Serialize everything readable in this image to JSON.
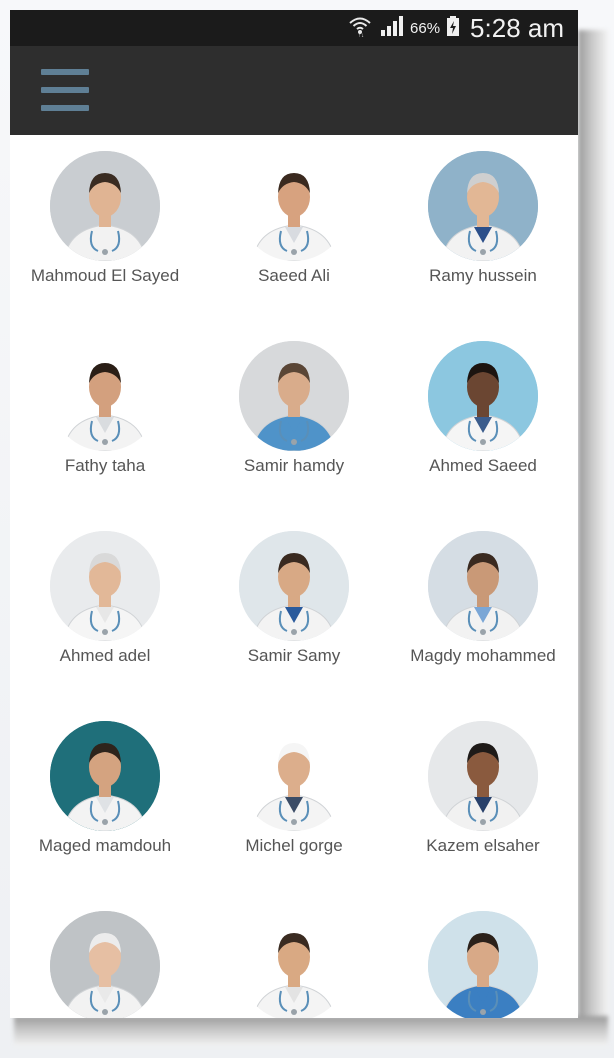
{
  "status_bar": {
    "battery": "66%",
    "time": "5:28 am",
    "icons": [
      "wifi-icon",
      "signal-icon",
      "battery-charging-icon"
    ]
  },
  "app_bar": {
    "menu_icon": "hamburger-menu-icon"
  },
  "doctors": [
    {
      "name": "Mahmoud El Sayed",
      "bg": "#c9cdd1",
      "coat": "#f2f2f2",
      "skin": "#e0b493",
      "hair": "#3a2c22",
      "shirt": "#f2f2f2"
    },
    {
      "name": "Saeed Ali",
      "bg": "#ffffff",
      "coat": "#f4f4f4",
      "skin": "#d7a27f",
      "hair": "#3b2a1f",
      "shirt": "#d8dbe0"
    },
    {
      "name": "Ramy hussein",
      "bg": "#8fb2c9",
      "coat": "#f2f2f2",
      "skin": "#e2b795",
      "hair": "#cfcfcf",
      "shirt": "#2c4f8a"
    },
    {
      "name": "Fathy taha",
      "bg": "#ffffff",
      "coat": "#f3f3f3",
      "skin": "#d3a07e",
      "hair": "#2a1e16",
      "shirt": "#d9dcdf"
    },
    {
      "name": "Samir hamdy",
      "bg": "#d7d9db",
      "coat": "#4f93c9",
      "skin": "#d9ac8b",
      "hair": "#5a4636",
      "shirt": "#4f93c9"
    },
    {
      "name": "Ahmed Saeed",
      "bg": "#8cc7e0",
      "coat": "#f5f5f5",
      "skin": "#6b4632",
      "hair": "#1c1410",
      "shirt": "#3b5c8c"
    },
    {
      "name": "Ahmed adel",
      "bg": "#e9ebed",
      "coat": "#f5f5f5",
      "skin": "#e2b898",
      "hair": "#d9d9d9",
      "shirt": "#e7e7e7"
    },
    {
      "name": "Samir Samy",
      "bg": "#dfe6ea",
      "coat": "#f3f3f3",
      "skin": "#d8a985",
      "hair": "#3a2a20",
      "shirt": "#2a5a9c"
    },
    {
      "name": "Magdy mohammed",
      "bg": "#d5dde4",
      "coat": "#f2f2f2",
      "skin": "#c99977",
      "hair": "#3a2a20",
      "shirt": "#7aa6d6"
    },
    {
      "name": "Maged mamdouh",
      "bg": "#1f6f7a",
      "coat": "#f3f3f3",
      "skin": "#d4a380",
      "hair": "#2e241c",
      "shirt": "#dfe2e5"
    },
    {
      "name": "Michel gorge",
      "bg": "#ffffff",
      "coat": "#f4f4f4",
      "skin": "#dcae8c",
      "hair": "#f5f5f5",
      "shirt": "#3b4c66"
    },
    {
      "name": "Kazem elsaher",
      "bg": "#e6e8ea",
      "coat": "#f1f1f1",
      "skin": "#8a5a3e",
      "hair": "#1e1a18",
      "shirt": "#28406a"
    },
    {
      "name": "",
      "bg": "#bfc3c6",
      "coat": "#f2f2f2",
      "skin": "#e6bfa3",
      "hair": "#ececec",
      "shirt": "#e9e9e9"
    },
    {
      "name": "",
      "bg": "#ffffff",
      "coat": "#f4f4f4",
      "skin": "#d9a983",
      "hair": "#3a2b21",
      "shirt": "#e3e3e3"
    },
    {
      "name": "",
      "bg": "#cfe1ea",
      "coat": "#3b7fc2",
      "skin": "#d8a987",
      "hair": "#2b211a",
      "shirt": "#3b7fc2"
    }
  ]
}
